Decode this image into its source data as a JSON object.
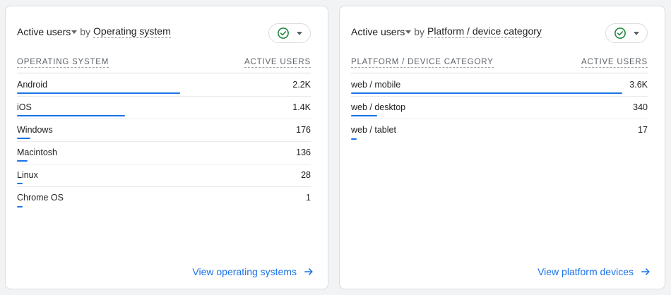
{
  "colors": {
    "accent": "#1a73e8",
    "success": "#188038",
    "border": "#dadce0"
  },
  "os_card": {
    "metric_label": "Active users",
    "by_label": "by",
    "dimension_label": "Operating system",
    "status_icon": "check-circle-icon",
    "header_left": "OPERATING SYSTEM",
    "header_right": "ACTIVE USERS",
    "rows": [
      {
        "label": "Android",
        "value": "2.2K",
        "share": 0.555
      },
      {
        "label": "iOS",
        "value": "1.4K",
        "share": 0.368
      },
      {
        "label": "Windows",
        "value": "176",
        "share": 0.046
      },
      {
        "label": "Macintosh",
        "value": "136",
        "share": 0.036
      },
      {
        "label": "Linux",
        "value": "28",
        "share": 0.008
      },
      {
        "label": "Chrome OS",
        "value": "1",
        "share": 0.002
      }
    ],
    "link_label": "View operating systems"
  },
  "platform_card": {
    "metric_label": "Active users",
    "by_label": "by",
    "dimension_label": "Platform / device category",
    "status_icon": "check-circle-icon",
    "header_left": "PLATFORM / DEVICE CATEGORY",
    "header_right": "ACTIVE USERS",
    "rows": [
      {
        "label": "web / mobile",
        "value": "3.6K",
        "share": 0.915
      },
      {
        "label": "web / desktop",
        "value": "340",
        "share": 0.087
      },
      {
        "label": "web / tablet",
        "value": "17",
        "share": 0.005
      }
    ],
    "link_label": "View platform devices"
  }
}
